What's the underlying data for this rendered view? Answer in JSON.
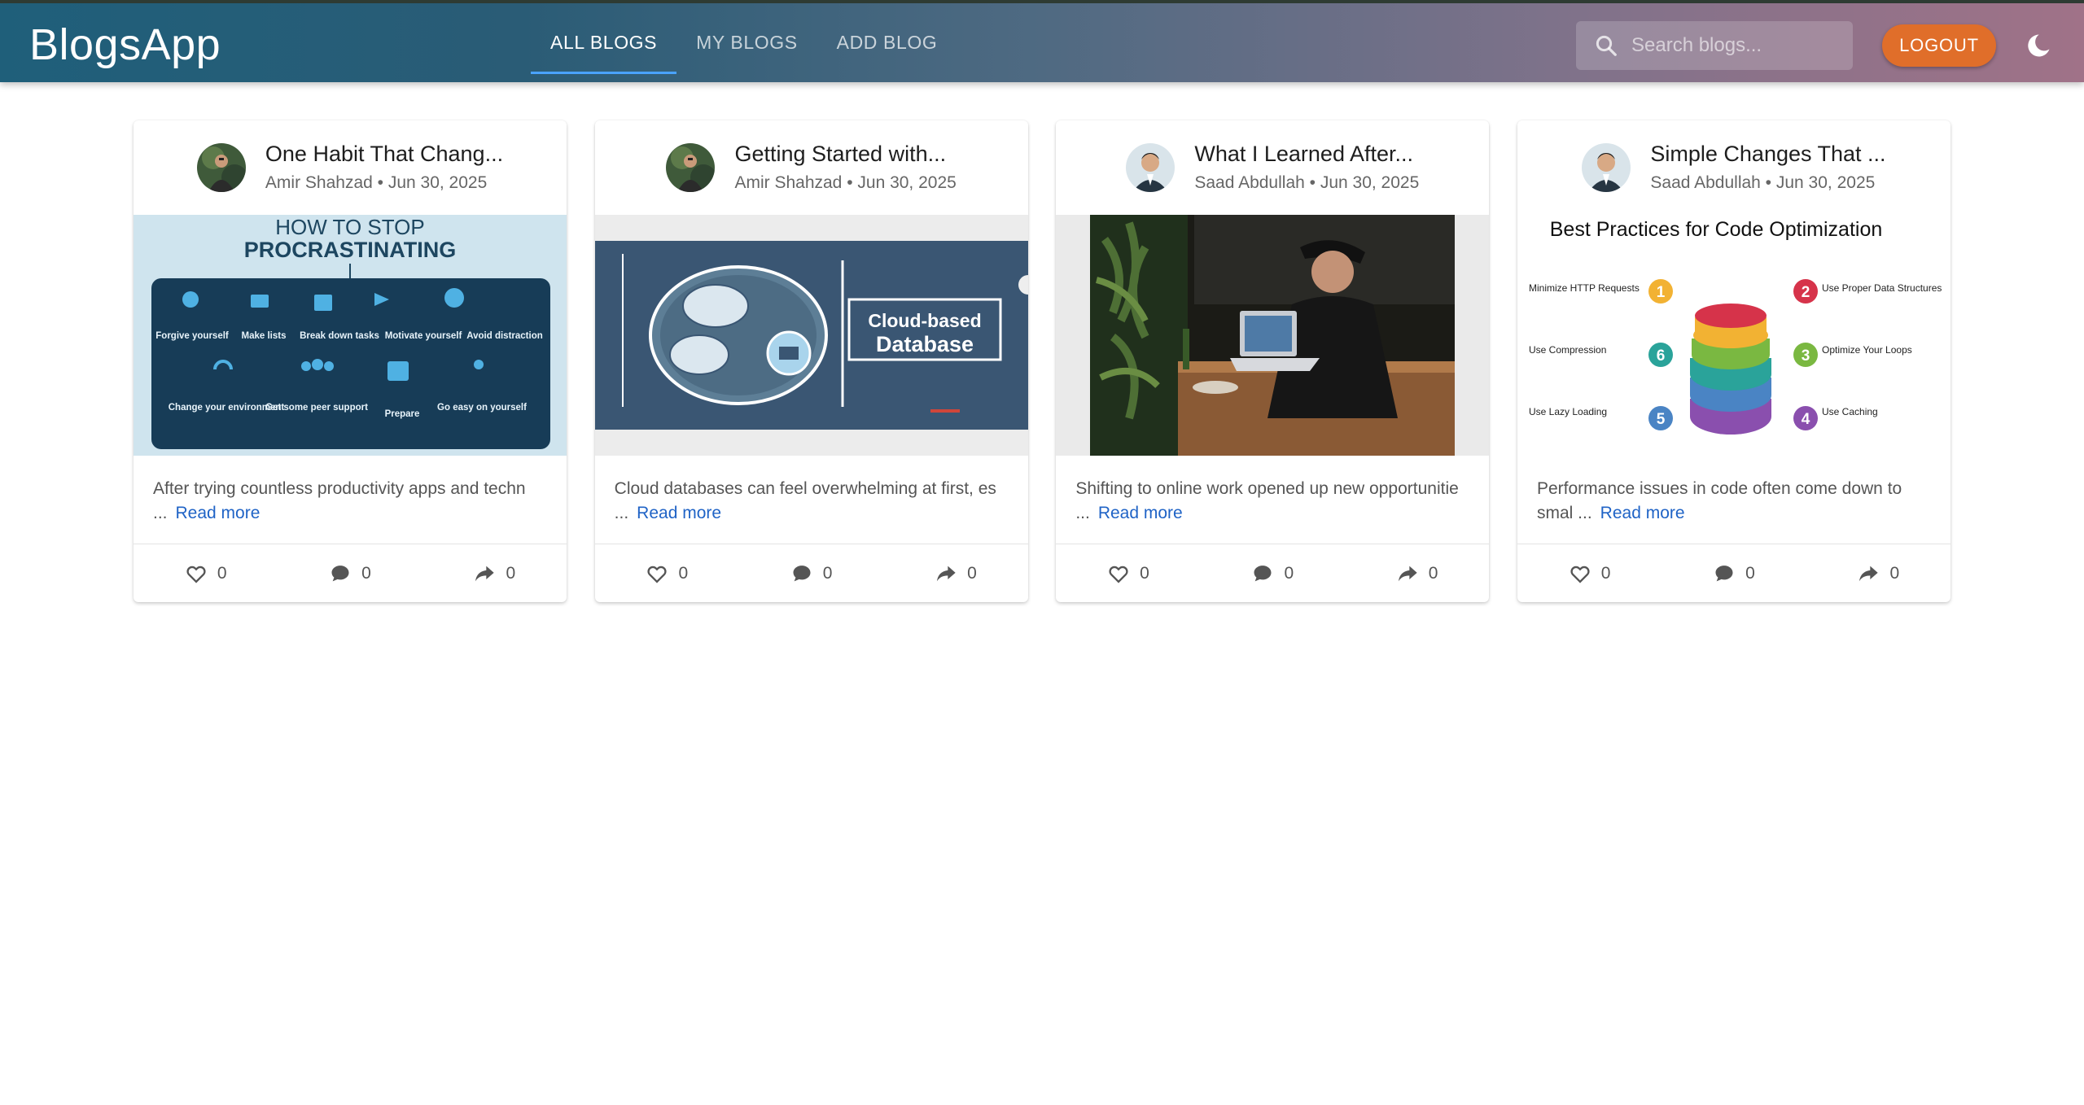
{
  "app": {
    "brand": "BlogsApp"
  },
  "nav": {
    "tabs": [
      {
        "label": "ALL BLOGS",
        "active": true
      },
      {
        "label": "MY BLOGS",
        "active": false
      },
      {
        "label": "ADD BLOG",
        "active": false
      }
    ]
  },
  "search": {
    "placeholder": "Search blogs...",
    "value": ""
  },
  "header": {
    "logout_label": "LOGOUT",
    "theme_icon": "moon-icon"
  },
  "colors": {
    "accent": "#4aa3ff",
    "logout": "#e06e2a",
    "link": "#1f63c6"
  },
  "cards": [
    {
      "title": "One Habit That Chang...",
      "meta": "Amir Shahzad • Jun 30, 2025",
      "excerpt": "After trying countless productivity apps and techn",
      "ellipsis": "...",
      "read_more": "Read more",
      "likes": "0",
      "comments": "0",
      "shares": "0",
      "image": {
        "line1": "HOW TO STOP",
        "line2": "PROCRASTINATING",
        "items": [
          "Forgive yourself",
          "Make lists",
          "Break down tasks",
          "Motivate yourself",
          "Avoid distraction",
          "Change your environment",
          "Get some peer support",
          "Prepare",
          "Go easy on yourself"
        ]
      }
    },
    {
      "title": "Getting Started with...",
      "meta": "Amir Shahzad • Jun 30, 2025",
      "excerpt": "Cloud databases can feel overwhelming at first, es",
      "ellipsis": "...",
      "read_more": "Read more",
      "likes": "0",
      "comments": "0",
      "shares": "0",
      "image": {
        "line1": "Cloud-based",
        "line2": "Database"
      }
    },
    {
      "title": "What I Learned After...",
      "meta": "Saad Abdullah • Jun 30, 2025",
      "excerpt": "Shifting to online work opened up new opportunitie",
      "ellipsis": "...",
      "read_more": "Read more",
      "likes": "0",
      "comments": "0",
      "shares": "0"
    },
    {
      "title": "Simple Changes That ...",
      "meta": "Saad Abdullah • Jun 30, 2025",
      "excerpt": "Performance issues in code often come down to",
      "excerpt2": "smal",
      "ellipsis": "...",
      "read_more": "Read more",
      "likes": "0",
      "comments": "0",
      "shares": "0",
      "image": {
        "heading": "Best Practices for Code Optimization",
        "left": [
          "Minimize HTTP Requests",
          "Use Compression",
          "Use Lazy Loading"
        ],
        "right": [
          "Use Proper Data Structures",
          "Optimize Your Loops",
          "Use Caching"
        ],
        "numbers": [
          "1",
          "6",
          "5",
          "2",
          "3",
          "4"
        ]
      }
    }
  ]
}
